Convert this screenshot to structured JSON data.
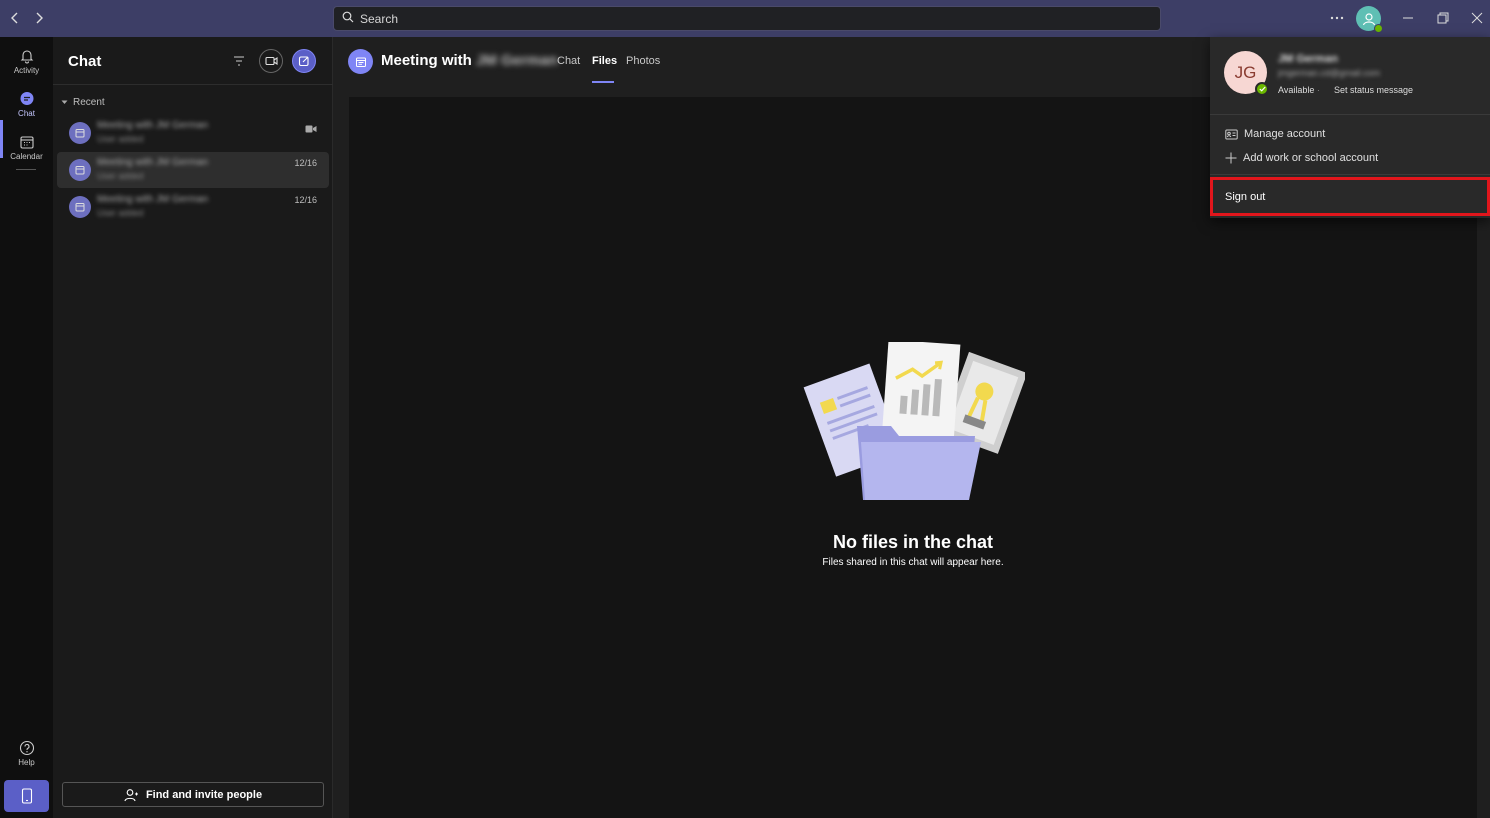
{
  "titlebar": {
    "search_placeholder": "Search",
    "accent": "#3d3e66"
  },
  "rail": {
    "items": [
      {
        "label": "Activity",
        "icon": "bell-icon"
      },
      {
        "label": "Chat",
        "icon": "chat-icon"
      },
      {
        "label": "Calendar",
        "icon": "calendar-icon"
      }
    ],
    "help_label": "Help"
  },
  "chatlist": {
    "title": "Chat",
    "section": "Recent",
    "rows": [
      {
        "name": "Meeting with JM German",
        "sub": "User added",
        "date": ""
      },
      {
        "name": "Meeting with JM German",
        "sub": "User added",
        "date": "12/16"
      },
      {
        "name": "Meeting with JM German",
        "sub": "User added",
        "date": "12/16"
      }
    ],
    "invite_label": "Find and invite people"
  },
  "main": {
    "title_prefix": "Meeting with",
    "title_name": "JM German",
    "tabs": [
      "Chat",
      "Files",
      "Photos"
    ],
    "active_tab": "Files",
    "empty_title": "No files in the chat",
    "empty_sub": "Files shared in this chat will appear here."
  },
  "account": {
    "initials": "JG",
    "name": "JM German",
    "email": "jmgerman.cd@gmail.com",
    "status": "Available",
    "status_sep": "·",
    "status_message": "Set status message",
    "manage": "Manage account",
    "add_account": "Add work or school account",
    "sign_out": "Sign out",
    "highlight_color": "#e1161c"
  }
}
